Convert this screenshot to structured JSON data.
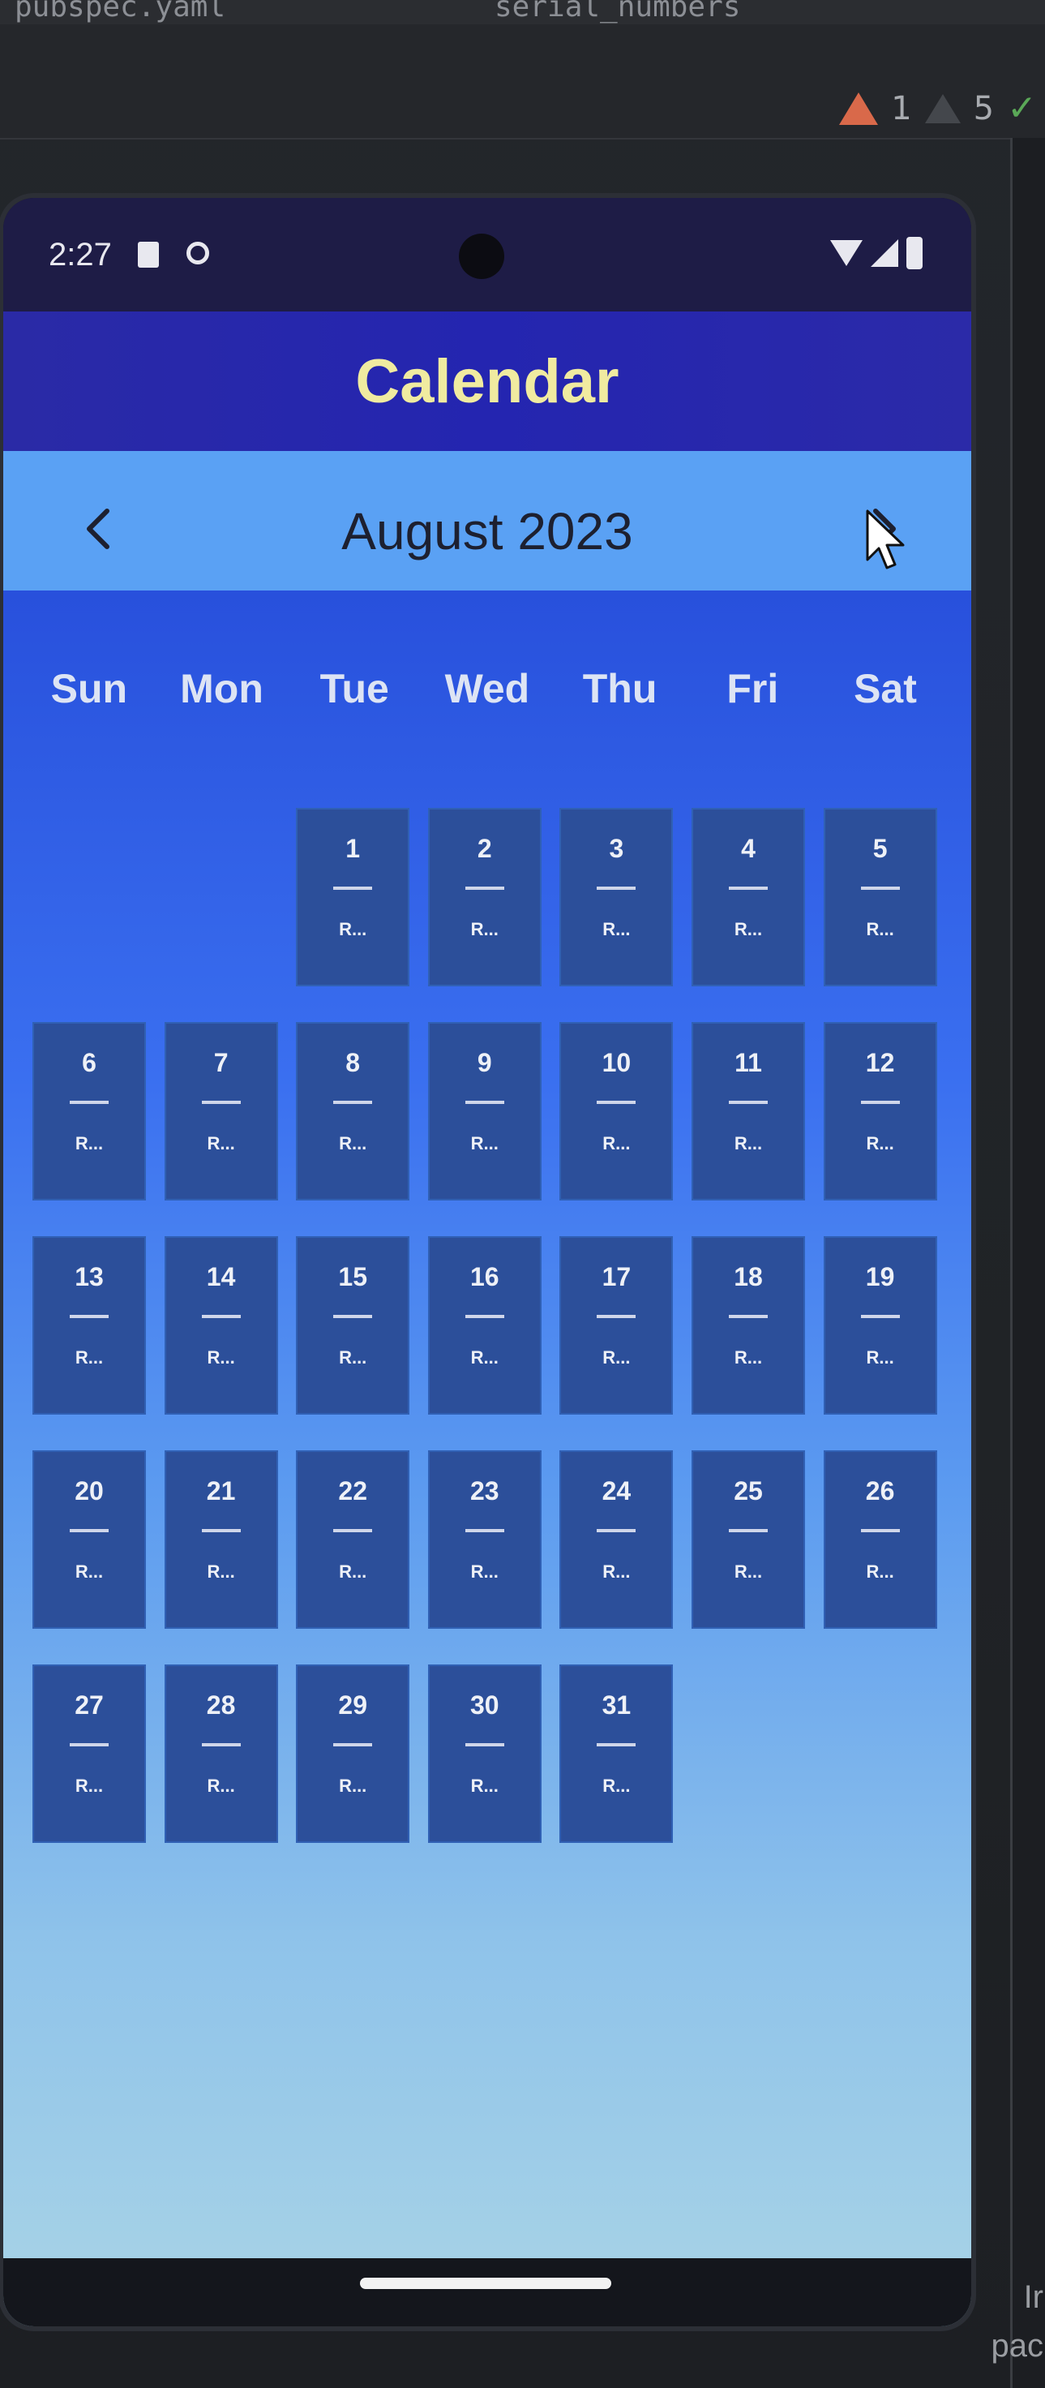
{
  "ide": {
    "tab_left": "pubspec.yaml",
    "tab_right": "serial_numbers",
    "warnings": "1",
    "weak_warnings": "5",
    "right_text_top": "Ir",
    "right_text_bottom": "pac"
  },
  "status_bar": {
    "time": "2:27"
  },
  "app_bar": {
    "title": "Calendar"
  },
  "month_nav": {
    "month_label": "August 2023",
    "prev_label": "‹",
    "next_label": "›"
  },
  "weekdays": [
    "Sun",
    "Mon",
    "Tue",
    "Wed",
    "Thu",
    "Fri",
    "Sat"
  ],
  "calendar": {
    "first_weekday_index": 2,
    "days": [
      {
        "num": "1",
        "tag": "R..."
      },
      {
        "num": "2",
        "tag": "R..."
      },
      {
        "num": "3",
        "tag": "R..."
      },
      {
        "num": "4",
        "tag": "R..."
      },
      {
        "num": "5",
        "tag": "R..."
      },
      {
        "num": "6",
        "tag": "R..."
      },
      {
        "num": "7",
        "tag": "R..."
      },
      {
        "num": "8",
        "tag": "R..."
      },
      {
        "num": "9",
        "tag": "R..."
      },
      {
        "num": "10",
        "tag": "R..."
      },
      {
        "num": "11",
        "tag": "R..."
      },
      {
        "num": "12",
        "tag": "R..."
      },
      {
        "num": "13",
        "tag": "R..."
      },
      {
        "num": "14",
        "tag": "R..."
      },
      {
        "num": "15",
        "tag": "R..."
      },
      {
        "num": "16",
        "tag": "R..."
      },
      {
        "num": "17",
        "tag": "R..."
      },
      {
        "num": "18",
        "tag": "R..."
      },
      {
        "num": "19",
        "tag": "R..."
      },
      {
        "num": "20",
        "tag": "R..."
      },
      {
        "num": "21",
        "tag": "R..."
      },
      {
        "num": "22",
        "tag": "R..."
      },
      {
        "num": "23",
        "tag": "R..."
      },
      {
        "num": "24",
        "tag": "R..."
      },
      {
        "num": "25",
        "tag": "R..."
      },
      {
        "num": "26",
        "tag": "R..."
      },
      {
        "num": "27",
        "tag": "R..."
      },
      {
        "num": "28",
        "tag": "R..."
      },
      {
        "num": "29",
        "tag": "R..."
      },
      {
        "num": "30",
        "tag": "R..."
      },
      {
        "num": "31",
        "tag": "R..."
      }
    ]
  },
  "colors": {
    "app_bar": "#2425b0",
    "title_text": "#f0eba0",
    "month_bar": "#5aa1f4",
    "day_cell": "#2c4f9a"
  }
}
